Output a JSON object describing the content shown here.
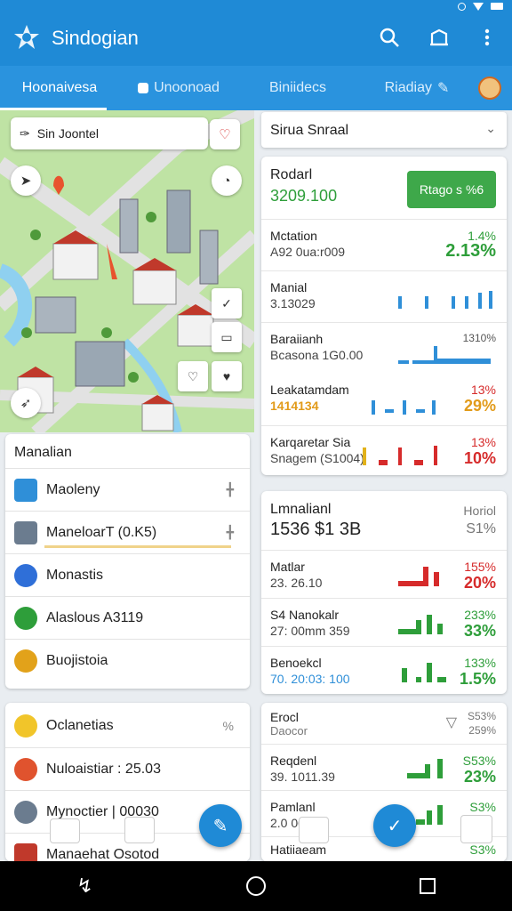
{
  "app": {
    "title": "Sindogian"
  },
  "tabs": [
    {
      "label": "Hoonaivesa"
    },
    {
      "label": "Unoonoad"
    },
    {
      "label": "Biniidecs"
    },
    {
      "label": "Riadiay"
    }
  ],
  "map": {
    "search_text": "Sin Joontel"
  },
  "list1": {
    "title": "Manalian",
    "items": [
      {
        "label": "Maoleny"
      },
      {
        "label": "ManeloarT (0.K5)"
      },
      {
        "label": "Monastis"
      },
      {
        "label": "Alaslous A3119"
      },
      {
        "label": "Buojistoia"
      }
    ]
  },
  "list2": {
    "items": [
      {
        "label": "Oclanetias"
      },
      {
        "label": "Nuloaistiar : 25.03"
      },
      {
        "label": "Mynoctier | 00030"
      },
      {
        "label": "Manaehat Osotod"
      }
    ]
  },
  "panel1": {
    "dropdown": "Sirua Snraal",
    "header_title": "Rodarl",
    "header_value": "3209.100",
    "action_button": "Rtago s %6",
    "rows": [
      {
        "label": "Mctation",
        "sub": "A92 0ua:r009",
        "pct": "1.4%",
        "big": "2.13%",
        "color": "#2e9e3a"
      },
      {
        "label": "Manial",
        "sub": "3.13029",
        "pct": "",
        "big": "",
        "color": "#2f8fd8"
      },
      {
        "label": "Baraiianh",
        "sub": "Bcasona 1G0.00",
        "pct": "1310%",
        "big": "",
        "color": "#2f8fd8"
      },
      {
        "label": "Leakatamdam",
        "sub": "1414134",
        "pct": "13%",
        "big": "29%",
        "color": "#2f8fd8"
      },
      {
        "label": "Karqaretar Sia",
        "sub": "Snagem (S1004)",
        "pct": "13%",
        "big": "10%",
        "color": "#d62b2b"
      }
    ]
  },
  "panel2": {
    "title": "Lmnalianl",
    "value": "1536 $1 3B",
    "right_top": "Horiol",
    "right_val": "S1%",
    "rows": [
      {
        "label": "Matlar",
        "sub": "23. 26.10",
        "pct": "155%",
        "big": "20%",
        "color": "#d62b2b"
      },
      {
        "label": "S4 Nanokalr",
        "sub": "27: 00mm 359",
        "pct": "233%",
        "big": "33%",
        "color": "#2e9e3a"
      },
      {
        "label": "Benoekcl",
        "sub": "70. 20:03: 100",
        "pct": "133%",
        "big": "1.5%",
        "color": "#2e9e3a"
      }
    ]
  },
  "panel3": {
    "title": "Erocl",
    "sub": "Daocor",
    "right_top": "S53%",
    "right_sub": "259%",
    "rows": [
      {
        "label": "Reqdenl",
        "sub": "39. 1011.39",
        "pct": "S53%",
        "big": "23%",
        "color": "#2e9e3a"
      },
      {
        "label": "Pamlanl",
        "sub": "2.0 00 59",
        "pct": "S3%",
        "big": "",
        "color": "#2e9e3a"
      },
      {
        "label": "Hatiiaeam",
        "sub": "",
        "pct": "S3%",
        "big": "",
        "color": "#2e9e3a"
      }
    ]
  },
  "colors": {
    "primary": "#1f8ad6",
    "green": "#2e9e3a",
    "red": "#d62b2b",
    "orange": "#e29b1a"
  }
}
